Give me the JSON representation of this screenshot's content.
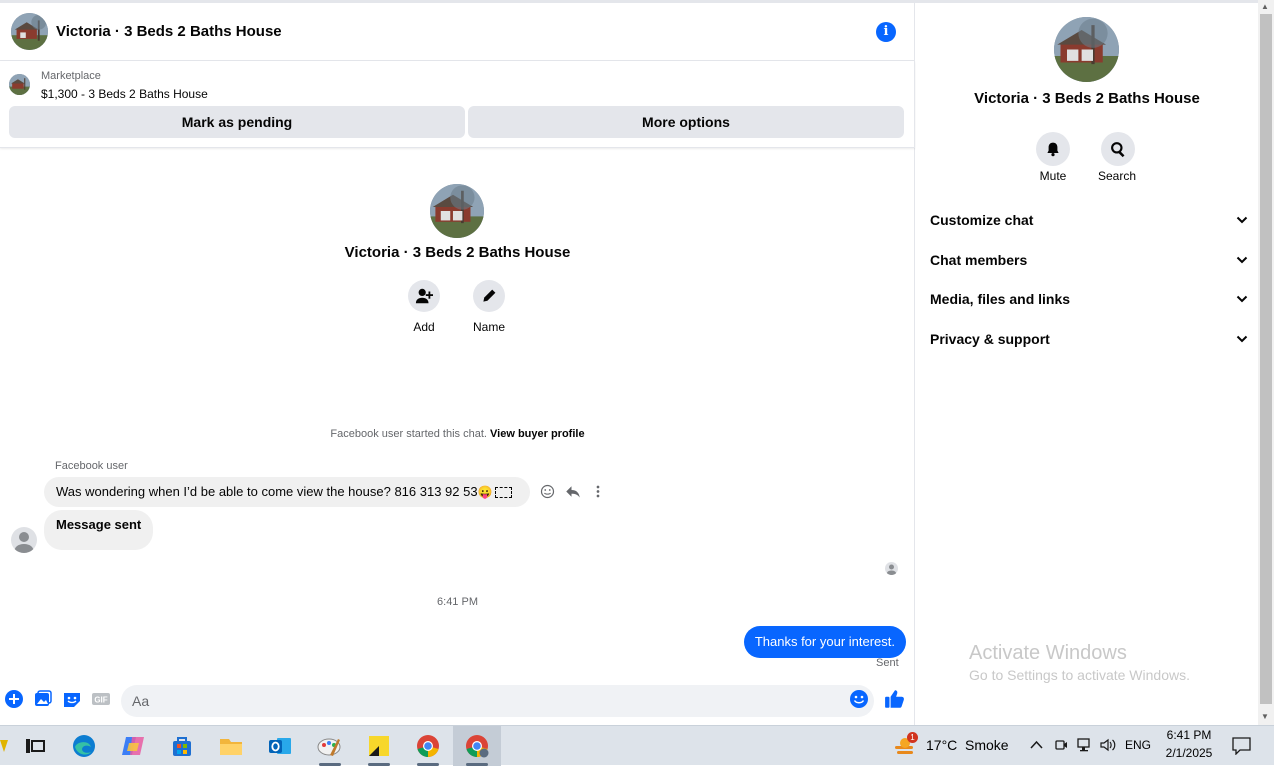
{
  "chat": {
    "title": "Victoria · 3 Beds 2 Baths House",
    "listing_label": "Marketplace",
    "listing_title": "$1,300 - 3 Beds 2 Baths House",
    "mark_pending_label": "Mark as pending",
    "more_options_label": "More options",
    "intro_title": "Victoria · 3 Beds 2 Baths House",
    "add_label": "Add",
    "name_label": "Name",
    "started_text": "Facebook user started this chat.",
    "buyer_profile_link": "View buyer profile",
    "sender_name": "Facebook user",
    "message_1": "Was wondering when I’d be able to come view the house? 816 313 92 53",
    "message_1_emoji": "😛",
    "message_2": "Message sent",
    "timestamp": "6:41 PM",
    "outgoing_message": "Thanks for your interest.",
    "sent_status": "Sent",
    "composer_placeholder": "Aa",
    "accent_color": "#0866ff"
  },
  "panel": {
    "title": "Victoria · 3 Beds 2 Baths House",
    "mute_label": "Mute",
    "search_label": "Search",
    "sections": [
      {
        "label": "Customize chat"
      },
      {
        "label": "Chat members"
      },
      {
        "label": "Media, files and links"
      },
      {
        "label": "Privacy & support"
      }
    ],
    "watermark_title": "Activate Windows",
    "watermark_sub": "Go to Settings to activate Windows."
  },
  "taskbar": {
    "apps": [
      "task-view-icon",
      "edge-icon",
      "copilot-icon",
      "store-icon",
      "file-explorer-icon",
      "outlook-icon",
      "paint-icon",
      "sticky-notes-icon",
      "chrome-icon",
      "chrome-profile-icon"
    ],
    "weather_temp": "17°C",
    "weather_text": "Smoke",
    "weather_badge": "1",
    "language": "ENG",
    "time": "6:41 PM",
    "date": "2/1/2025"
  }
}
